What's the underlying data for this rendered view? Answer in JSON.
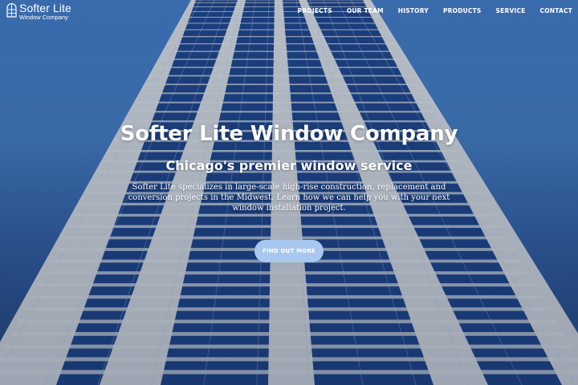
{
  "brand": {
    "name": "Softer Lite",
    "subtitle": "Window Company",
    "icon": "arched-window-icon"
  },
  "nav": {
    "items": [
      {
        "label": "PROJECTS"
      },
      {
        "label": "OUR TEAM"
      },
      {
        "label": "HISTORY"
      },
      {
        "label": "PRODUCTS"
      },
      {
        "label": "SERVICE"
      },
      {
        "label": "CONTACT"
      }
    ]
  },
  "hero": {
    "title": "Softer Lite Window Company",
    "subtitle": "Chicago's premier window service",
    "description": "Softer Lite specializes in large-scale high-rise construction, replacement and conversion projects in the Midwest. Learn how we can help you with your next window installation project.",
    "cta_label": "FIND OUT MORE",
    "background": "high-rise-building-photo"
  },
  "colors": {
    "accent": "#a9c8ef",
    "sky": "#3e72b2",
    "glass": "#1b3f7f",
    "facade": "#c6cbd1"
  }
}
